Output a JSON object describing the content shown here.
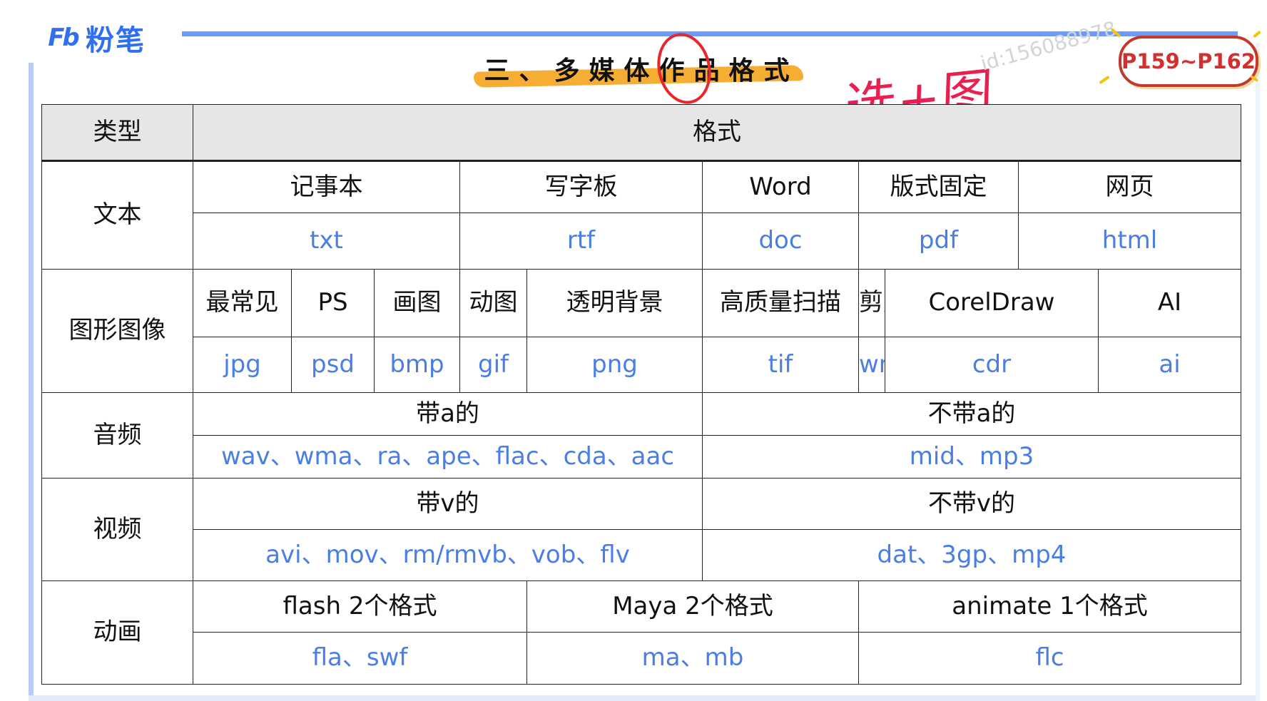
{
  "logo": {
    "mark": "Fb",
    "text": "粉笔"
  },
  "title": "三、多媒体作品格式",
  "handnote": "选+图",
  "watermark": "id:156088978",
  "page_ref": "P159~P162",
  "colors": {
    "accent": "#4a7ee5",
    "frame": "#6f9af0",
    "brand": "#2f6ff0",
    "badge": "#d32f2f",
    "highlight": "#f5a623"
  },
  "table": {
    "header": {
      "type": "类型",
      "format": "格式"
    },
    "text": {
      "label": "文本",
      "items": [
        {
          "name": "记事本",
          "ext": "txt"
        },
        {
          "name": "写字板",
          "ext": "rtf"
        },
        {
          "name": "Word",
          "ext": "doc"
        },
        {
          "name": "版式固定",
          "ext": "pdf"
        },
        {
          "name": "网页",
          "ext": "html"
        }
      ]
    },
    "image": {
      "label": "图形图像",
      "items": [
        {
          "name": "最常见",
          "ext": "jpg"
        },
        {
          "name": "PS",
          "ext": "psd"
        },
        {
          "name": "画图",
          "ext": "bmp"
        },
        {
          "name": "动图",
          "ext": "gif"
        },
        {
          "name": "透明背景",
          "ext": "png"
        },
        {
          "name": "高质量扫描",
          "ext": "tif"
        },
        {
          "name": "剪贴画",
          "ext": "wmf"
        },
        {
          "name": "CorelDraw",
          "ext": "cdr"
        },
        {
          "name": "AI",
          "ext": "ai"
        }
      ]
    },
    "audio": {
      "label": "音频",
      "items": [
        {
          "name": "带a的",
          "ext": "wav、wma、ra、ape、flac、cda、aac"
        },
        {
          "name": "不带a的",
          "ext": "mid、mp3"
        }
      ]
    },
    "video": {
      "label": "视频",
      "items": [
        {
          "name": "带v的",
          "ext": "avi、mov、rm/rmvb、vob、flv"
        },
        {
          "name": "不带v的",
          "ext": "dat、3gp、mp4"
        }
      ]
    },
    "animation": {
      "label": "动画",
      "items": [
        {
          "name": "flash 2个格式",
          "ext": "fla、swf"
        },
        {
          "name": "Maya 2个格式",
          "ext": "ma、mb"
        },
        {
          "name": "animate 1个格式",
          "ext": "flc"
        }
      ]
    }
  }
}
